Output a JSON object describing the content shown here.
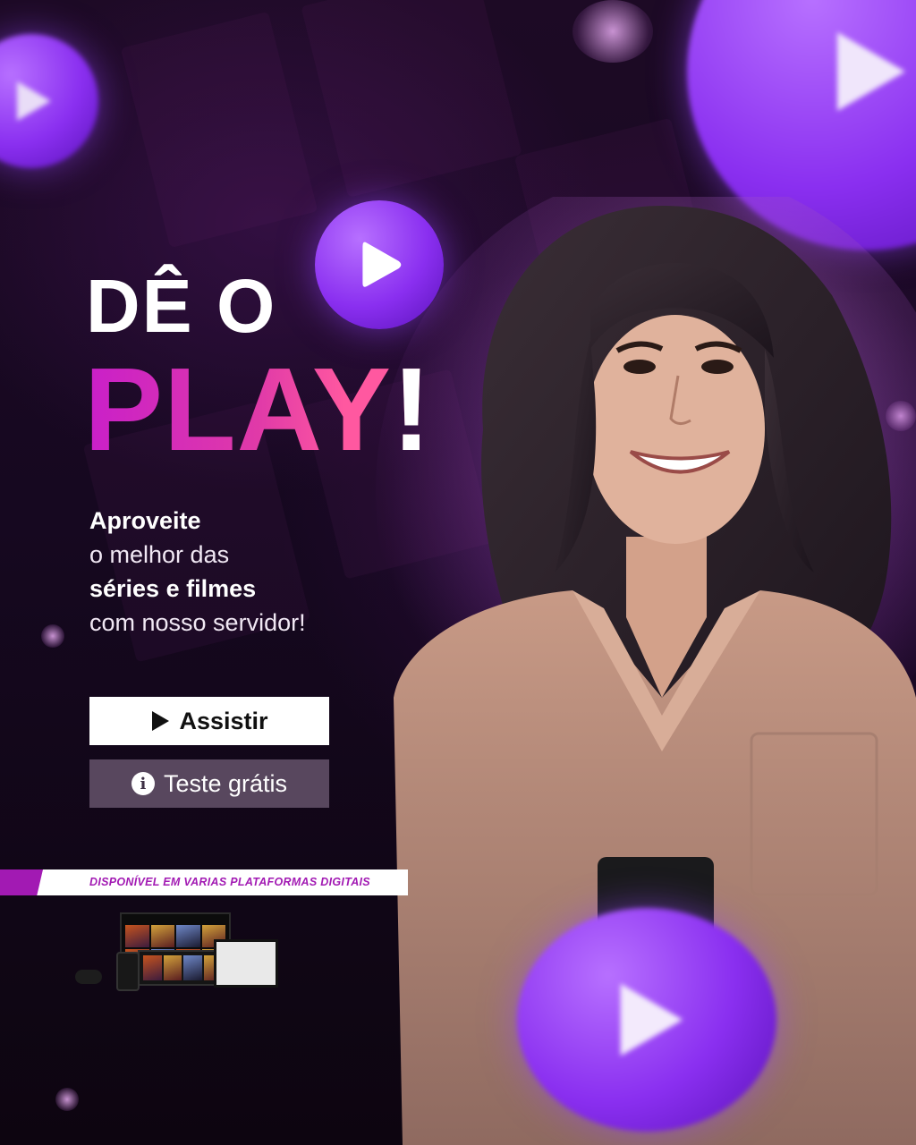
{
  "headline": {
    "line1": "DÊ O",
    "line2": "PLAY",
    "bang": "!"
  },
  "body": {
    "line1": "Aproveite",
    "line2": "o melhor das",
    "line3": "séries e filmes",
    "line4": "com nosso servidor!"
  },
  "buttons": {
    "primary_label": "Assistir",
    "secondary_label": "Teste grátis",
    "info_glyph": "i"
  },
  "ribbon": {
    "text": "DISPONÍVEL EM VARIAS PLATAFORMAS DIGITAIS"
  },
  "icons": [
    "play-icon",
    "info-icon"
  ],
  "colors": {
    "accent_magenta": "#a21ab3",
    "accent_purple": "#8a2ff0",
    "background": "#120716",
    "secondary_button": "#58475e"
  }
}
